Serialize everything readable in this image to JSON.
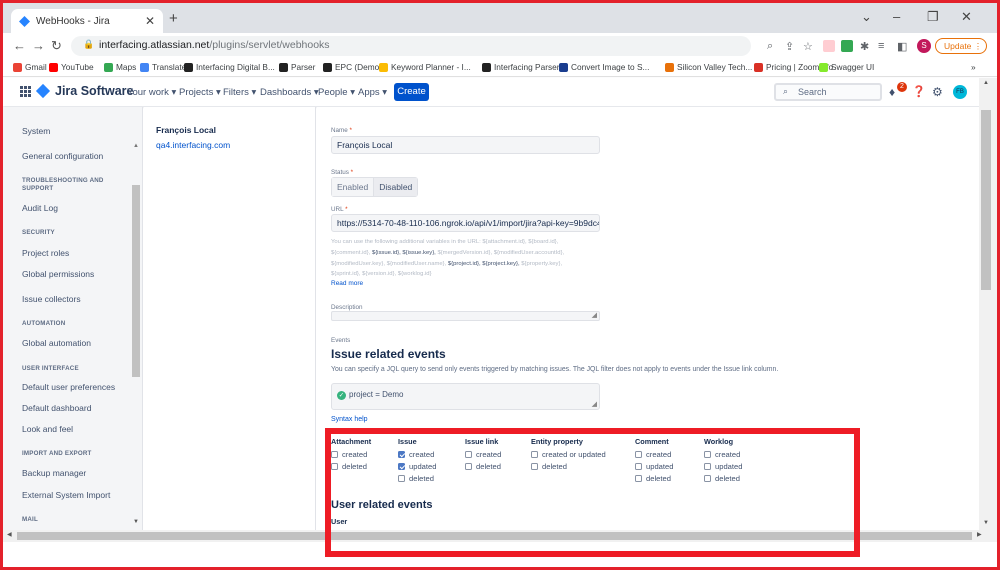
{
  "browser": {
    "tab_title": "WebHooks - Jira",
    "url_host": "interfacing.atlassian.net",
    "url_path": "/plugins/servlet/webhooks",
    "update_label": "Update",
    "profile_initial": "S",
    "bookmarks": [
      "Gmail",
      "YouTube",
      "Maps",
      "Translate",
      "Interfacing Digital B...",
      "Parser",
      "EPC (Demo)",
      "Keyword Planner - I...",
      "Interfacing Parser",
      "Convert Image to S...",
      "Silicon Valley Tech...",
      "Pricing | ZoomInfo",
      "Swagger UI"
    ],
    "bookmark_colors": [
      "#ea4335",
      "#ff0000",
      "#34a853",
      "#4285f4",
      "#222222",
      "#222222",
      "#222222",
      "#fbbc04",
      "#222222",
      "#1a3d8f",
      "#e8710a",
      "#d93025",
      "#85ea2d"
    ]
  },
  "jira": {
    "product": "Jira Software",
    "nav": [
      "Your work ▾",
      "Projects ▾",
      "Filters ▾",
      "Dashboards ▾",
      "People ▾",
      "Apps ▾"
    ],
    "create_label": "Create",
    "search_placeholder": "Search",
    "notification_count": "2",
    "user_initials": "FB"
  },
  "sidebar": {
    "title": "System",
    "general": "General configuration",
    "sections": [
      {
        "heading": "TROUBLESHOOTING AND SUPPORT",
        "items": [
          "Audit Log"
        ]
      },
      {
        "heading": "SECURITY",
        "items": [
          "Project roles",
          "Global permissions",
          "Issue collectors"
        ]
      },
      {
        "heading": "AUTOMATION",
        "items": [
          "Global automation"
        ]
      },
      {
        "heading": "USER INTERFACE",
        "items": [
          "Default user preferences",
          "Default dashboard",
          "Look and feel"
        ]
      },
      {
        "heading": "IMPORT AND EXPORT",
        "items": [
          "Backup manager",
          "External System Import"
        ]
      },
      {
        "heading": "MAIL",
        "items": []
      }
    ]
  },
  "webhook_list": {
    "name": "François Local",
    "site": "qa4.interfacing.com"
  },
  "form": {
    "name_label": "Name",
    "name_value": "François Local",
    "status_label": "Status",
    "status_options": [
      "Enabled",
      "Disabled"
    ],
    "url_label": "URL",
    "url_value": "https://5314-70-48-110-106.ngrok.io/api/v1/import/jira?api-key=9b9dc4d4-88",
    "help_text_intro": "You can use the following additional variables in the URL: ${attachment.id}, ${board.id}, ${comment.id}, ",
    "help_text_vars": "${issue.id}, ${issue.key}, ",
    "help_text_mid": "${mergedVersion.id}, ${modifiedUser.accountId}, ${modifiedUser.key}, ${modifiedUser.name}, ",
    "help_text_vars2": "${project.id}, ${project.key}, ",
    "help_text_end": "${property.key}, ${sprint.id}, ${version.id}, ${worklog.id}",
    "read_more": "Read more",
    "description_label": "Description",
    "events_label": "Events",
    "issue_events_heading": "Issue related events",
    "jql_description": "You can specify a JQL query to send only events triggered by matching issues. The JQL filter does not apply to events under the Issue link column.",
    "jql_value": "project = Demo",
    "syntax_help": "Syntax help",
    "user_events_heading": "User related events",
    "user_column": "User"
  },
  "events": {
    "columns": [
      {
        "header": "Attachment",
        "items": [
          {
            "label": "created",
            "checked": false
          },
          {
            "label": "deleted",
            "checked": false
          }
        ]
      },
      {
        "header": "Issue",
        "items": [
          {
            "label": "created",
            "checked": true
          },
          {
            "label": "updated",
            "checked": true
          },
          {
            "label": "deleted",
            "checked": false
          }
        ]
      },
      {
        "header": "Issue link",
        "items": [
          {
            "label": "created",
            "checked": false
          },
          {
            "label": "deleted",
            "checked": false
          }
        ]
      },
      {
        "header": "Entity property",
        "items": [
          {
            "label": "created or updated",
            "checked": false
          },
          {
            "label": "deleted",
            "checked": false
          }
        ]
      },
      {
        "header": "Comment",
        "items": [
          {
            "label": "created",
            "checked": false
          },
          {
            "label": "updated",
            "checked": false
          },
          {
            "label": "deleted",
            "checked": false
          }
        ]
      },
      {
        "header": "Worklog",
        "items": [
          {
            "label": "created",
            "checked": false
          },
          {
            "label": "updated",
            "checked": false
          },
          {
            "label": "deleted",
            "checked": false
          }
        ]
      }
    ]
  }
}
